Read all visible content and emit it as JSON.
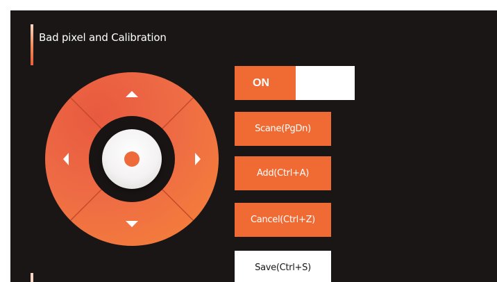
{
  "section": {
    "title": "Bad pixel and Calibration"
  },
  "dpad": {
    "up_icon": "arrow-up-icon",
    "down_icon": "arrow-down-icon",
    "left_icon": "arrow-left-icon",
    "right_icon": "arrow-right-icon",
    "center_icon": "center-dot-icon"
  },
  "toggle": {
    "label": "ON",
    "state": "on"
  },
  "buttons": {
    "scane": "Scane(PgDn)",
    "add": "Add(Ctrl+A)",
    "cancel": "Cancel(Ctrl+Z)",
    "save": "Save(Ctrl+S)"
  },
  "colors": {
    "accent": "#f06b34",
    "panel_background": "#1a1616",
    "text_light": "#ffffff"
  }
}
